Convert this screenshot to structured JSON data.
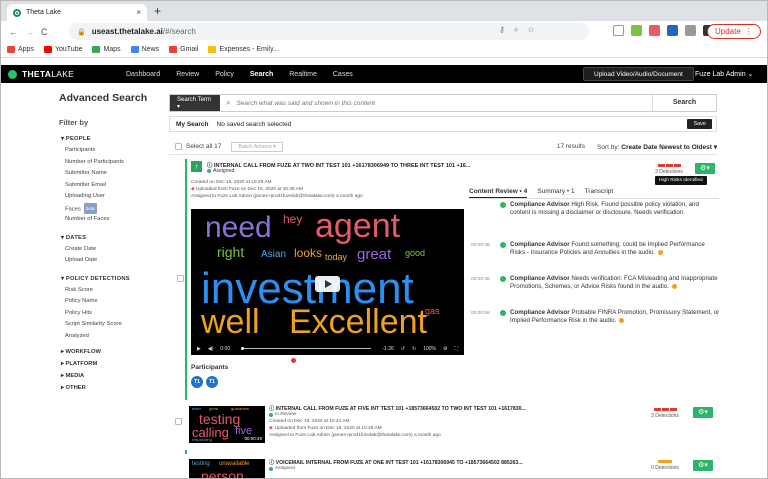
{
  "browser": {
    "tab_title": "Theta Lake",
    "tab_close": "×",
    "new_tab": "+",
    "url_host": "useast.thetalake.ai",
    "url_path": "/#/search",
    "update_label": "Update",
    "bookmarks": [
      {
        "label": "Apps",
        "color": "#e8453c"
      },
      {
        "label": "YouTube",
        "color": "#ff0000"
      },
      {
        "label": "Maps",
        "color": "#34a853"
      },
      {
        "label": "News",
        "color": "#4285f4"
      },
      {
        "label": "Gmail",
        "color": "#ea4335"
      },
      {
        "label": "Expenses - Emily...",
        "color": "#fbbc04"
      }
    ]
  },
  "app": {
    "logo": {
      "bold": "THETA",
      "light": "LAKE"
    },
    "nav": [
      "Dashboard",
      "Review",
      "Policy",
      "Search",
      "Realtime",
      "Cases"
    ],
    "active_nav": "Search",
    "upload_label": "Upload Video/Audio/Document",
    "user_label": "Fuze Lab Admin ⌄"
  },
  "sidebar": {
    "title": "Advanced Search",
    "filter_by": "Filter by",
    "people_header": "▾ PEOPLE",
    "people_items": [
      "Participants",
      "Number of Participants",
      "Submitter Name",
      "Submitter Email",
      "Uploading User",
      "Faces",
      "Number of Faces"
    ],
    "faces_badge": "beta",
    "dates_header": "▾ DATES",
    "dates_items": [
      "Create Date",
      "Upload Date"
    ],
    "policy_header": "▾ POLICY DETECTIONS",
    "policy_items": [
      "Risk Score",
      "Policy Name",
      "Policy Hits",
      "Script Similarity Score",
      "Analyzed"
    ],
    "collapsed_sections": [
      "▸ WORKFLOW",
      "▸ PLATFORM",
      "▸ MEDIA",
      "▸ OTHER"
    ]
  },
  "search": {
    "term_label": "Search Term ▾",
    "placeholder": "Search what was said and shown in this content",
    "search_button": "Search",
    "my_search_label": "My Search",
    "my_search_value": "No saved search selected",
    "save_button": "Save"
  },
  "toolbar": {
    "select_all": "Select all 17",
    "batch_actions": "Batch Actions ▾",
    "results_count": "17 results",
    "sort_label": "Sort by:",
    "sort_value": "Create Date Newest to Oldest ▾"
  },
  "result1": {
    "title": "INTERNAL CALL FROM FUZE AT TWO INT TEST 101 +16178306949 TO THREE INT TEST 101 +16...",
    "status": "Assigned",
    "status_color": "#2db36a",
    "created": "Created on Dec 16, 2020 at 10:29 AM",
    "uploaded": "Uploaded from Fuze on Dec 16, 2020 at 10:35 AM",
    "assigned": "Assigned to Fuze Lab Admin (james+prod1fuzelab@thetalake.com) a month ago",
    "detections": "3 Detections",
    "tooltip": "High Risks Identified",
    "tabs": [
      "Content Review • 4",
      "Summary • 1",
      "Transcript"
    ],
    "video_words": [
      {
        "text": "need",
        "color": "#8f6fd6"
      },
      {
        "text": "hey",
        "color": "#e0566e"
      },
      {
        "text": "agent",
        "color": "#e85a6a"
      },
      {
        "text": "right",
        "color": "#7cc242"
      },
      {
        "text": "Asian",
        "color": "#4fa6e0"
      },
      {
        "text": "looks",
        "color": "#f0a21d"
      },
      {
        "text": "today",
        "color": "#e8b12a"
      },
      {
        "text": "great",
        "color": "#9a6ad6"
      },
      {
        "text": "good",
        "color": "#7cc242"
      },
      {
        "text": "investment",
        "color": "#2d8ff0"
      },
      {
        "text": "well",
        "color": "#f0a21d"
      },
      {
        "text": "Excellent",
        "color": "#f0a21d"
      },
      {
        "text": "gas",
        "color": "#e85a6a"
      }
    ],
    "video_time_start": "0:00",
    "video_time_end": "-1:26",
    "video_speed": "100%",
    "participants_label": "Participants",
    "participants": [
      "T1",
      "T1"
    ],
    "findings": [
      {
        "ts": "",
        "label": "Compliance Advisor",
        "text": "High Risk. Found possible policy violation, and content is missing a disclaimer or disclosure. Needs verification."
      },
      {
        "ts": "00:00:48",
        "label": "Compliance Advisor",
        "text": "Found something; could be Implied Performance Risks - Insurance Policies and Annuities in the audio."
      },
      {
        "ts": "00:00:48",
        "label": "Compliance Advisor",
        "text": "Needs verification: FCA Misleading and Inappropriate Promotions, Schemes, or Advice Risks found in the audio."
      },
      {
        "ts": "00:00:58",
        "label": "Compliance Advisor",
        "text": "Probable FINRA Promotion, Promissory Statement, or Implied Performance Risk in the audio."
      }
    ]
  },
  "result2": {
    "title": "INTERNAL CALL FROM FUZE AT FIVE INT TEST 101 +18573664502 TO TWO INT TEST 101 +1617830...",
    "status": "In Review",
    "status_color": "#2db36a",
    "created": "Created on Dec 16, 2020 at 10:21 AM",
    "uploaded": "Uploaded from Fuze on Dec 16, 2020 at 10:25 AM",
    "assigned": "Assigned to Fuze Lab Admin (james+prod1fuzelab@thetalake.com) a month ago",
    "detections": "3 Detections",
    "thumb_words": [
      "team",
      "great",
      "guarantee",
      "testing",
      "calling",
      "five",
      "responding"
    ],
    "thumb_time": "00:00:49"
  },
  "result3": {
    "title": "VOICEMAIL INTERNAL FROM FUZE AT ONE INT TEST 101 +16178306945 TO +18573664502 885263...",
    "status": "Assigned",
    "status_color": "#2db36a",
    "detections": "0 Detections",
    "thumb_words": [
      "testing",
      "unavailable",
      "person"
    ]
  }
}
